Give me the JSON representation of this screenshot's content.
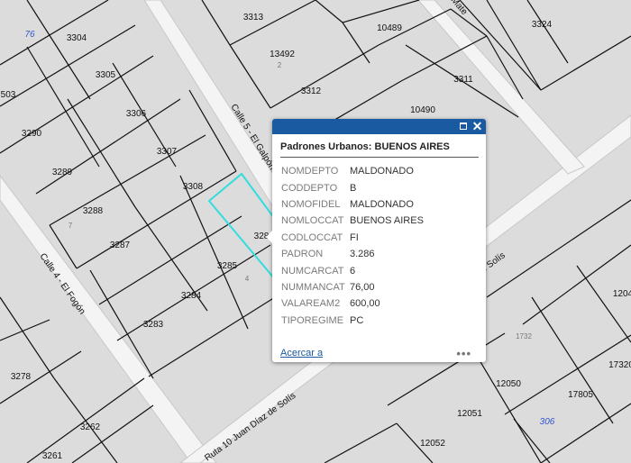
{
  "map": {
    "streets": [
      "Calle 5 - El Galpón",
      "Calle 4 - El Fogón",
      "Ruta 10 Juan Díaz de Solís",
      "Juan Díaz de Solís",
      "Mate"
    ],
    "parcels": [
      "3313",
      "10489",
      "3324",
      "3304",
      "3305",
      "13492",
      "3312",
      "3311",
      "3306",
      "10490",
      "3290",
      "3307",
      "3289",
      "3308",
      "3288",
      "3287",
      "3285",
      "3284",
      "3283",
      "3278",
      "3262",
      "3261",
      "12050",
      "17805",
      "12051",
      "12052",
      "1204",
      "17320",
      "503"
    ],
    "small_labels": [
      "2",
      "7",
      "4",
      "1732"
    ],
    "blue_labels": [
      "76",
      "306"
    ],
    "selected_parcel_partial": "328"
  },
  "popup": {
    "title": "Padrones Urbanos: BUENOS AIRES",
    "attributes": [
      {
        "key": "NOMDEPTO",
        "value": "MALDONADO"
      },
      {
        "key": "CODDEPTO",
        "value": "B"
      },
      {
        "key": "NOMOFIDEL",
        "value": "MALDONADO"
      },
      {
        "key": "NOMLOCCAT",
        "value": "BUENOS AIRES"
      },
      {
        "key": "CODLOCCAT",
        "value": "FI"
      },
      {
        "key": "PADRON",
        "value": "3.286"
      },
      {
        "key": "NUMCARCAT",
        "value": "6"
      },
      {
        "key": "NUMMANCAT",
        "value": "76,00"
      },
      {
        "key": "VALAREAM2",
        "value": "600,00"
      },
      {
        "key": "TIPOREGIME",
        "value": "PC"
      }
    ],
    "zoom_label": "Acercar a",
    "more_label": "•••",
    "close_label": "✕"
  },
  "colors": {
    "street": "#f4f4f4",
    "parcel_line": "#111111",
    "highlight": "#33dddd",
    "popup_bar": "#1a5aa0"
  }
}
